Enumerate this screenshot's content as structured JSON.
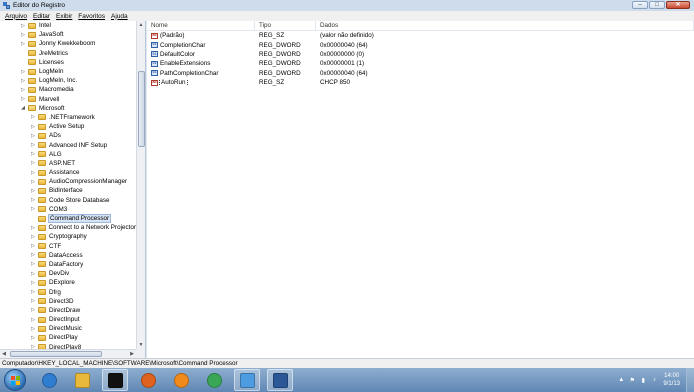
{
  "window": {
    "title": "Editor do Registro",
    "controls": {
      "minimize": "–",
      "maximize": "□",
      "close": "✕"
    }
  },
  "menu": [
    "Arquivo",
    "Editar",
    "Exibir",
    "Favoritos",
    "Ajuda"
  ],
  "tree": {
    "items": [
      {
        "label": "Intel",
        "expander": "▷"
      },
      {
        "label": "JavaSoft",
        "expander": "▷"
      },
      {
        "label": "Jonny Kwekkeboom",
        "expander": "▷"
      },
      {
        "label": "JreMetrics",
        "expander": ""
      },
      {
        "label": "Licenses",
        "expander": ""
      },
      {
        "label": "LogMeIn",
        "expander": "▷"
      },
      {
        "label": "LogMeIn, Inc.",
        "expander": "▷"
      },
      {
        "label": "Macromedia",
        "expander": "▷"
      },
      {
        "label": "Marvell",
        "expander": "▷"
      },
      {
        "label": "Microsoft",
        "expander": "◢"
      },
      {
        "label": ".NETFramework",
        "expander": "▷"
      },
      {
        "label": "Active Setup",
        "expander": "▷"
      },
      {
        "label": "ADs",
        "expander": "▷"
      },
      {
        "label": "Advanced INF Setup",
        "expander": "▷"
      },
      {
        "label": "ALG",
        "expander": "▷"
      },
      {
        "label": "ASP.NET",
        "expander": "▷"
      },
      {
        "label": "Assistance",
        "expander": "▷"
      },
      {
        "label": "AudioCompressionManager",
        "expander": "▷"
      },
      {
        "label": "BidInterface",
        "expander": "▷"
      },
      {
        "label": "Code Store Database",
        "expander": "▷"
      },
      {
        "label": "COM3",
        "expander": "▷"
      },
      {
        "label": "Command Processor",
        "expander": "",
        "selected": true
      },
      {
        "label": "Connect to a Network Projector",
        "expander": "▷"
      },
      {
        "label": "Cryptography",
        "expander": "▷"
      },
      {
        "label": "CTF",
        "expander": "▷"
      },
      {
        "label": "DataAccess",
        "expander": "▷"
      },
      {
        "label": "DataFactory",
        "expander": "▷"
      },
      {
        "label": "DevDiv",
        "expander": "▷"
      },
      {
        "label": "DExplore",
        "expander": "▷"
      },
      {
        "label": "Dfrg",
        "expander": "▷"
      },
      {
        "label": "Direct3D",
        "expander": "▷"
      },
      {
        "label": "DirectDraw",
        "expander": "▷"
      },
      {
        "label": "DirectInput",
        "expander": "▷"
      },
      {
        "label": "DirectMusic",
        "expander": "▷"
      },
      {
        "label": "DirectPlay",
        "expander": "▷"
      },
      {
        "label": "DirectPlay8",
        "expander": "▷"
      }
    ],
    "scroll": {
      "up": "▲",
      "down": "▼",
      "left": "◀",
      "right": "▶"
    }
  },
  "values": {
    "columns": [
      "Nome",
      "Tipo",
      "Dados"
    ],
    "rows": [
      {
        "name": "(Padrão)",
        "type": "REG_SZ",
        "data": "(valor não definido)",
        "icon": "ab",
        "icon_name": "string-value-icon"
      },
      {
        "name": "CompletionChar",
        "type": "REG_DWORD",
        "data": "0x00000040 (64)",
        "icon": "01",
        "icon_name": "dword-value-icon"
      },
      {
        "name": "DefaultColor",
        "type": "REG_DWORD",
        "data": "0x00000000 (0)",
        "icon": "01",
        "icon_name": "dword-value-icon"
      },
      {
        "name": "EnableExtensions",
        "type": "REG_DWORD",
        "data": "0x00000001 (1)",
        "icon": "01",
        "icon_name": "dword-value-icon"
      },
      {
        "name": "PathCompletionChar",
        "type": "REG_DWORD",
        "data": "0x00000040 (64)",
        "icon": "01",
        "icon_name": "dword-value-icon"
      },
      {
        "name": "AutoRun",
        "type": "REG_SZ",
        "data": "CHCP 850",
        "icon": "ab",
        "icon_name": "string-value-icon",
        "focused": true
      }
    ]
  },
  "status": {
    "path": "Computador\\HKEY_LOCAL_MACHINE\\SOFTWARE\\Microsoft\\Command Processor"
  },
  "taskbar": {
    "apps": [
      {
        "name": "internet-explorer-icon",
        "color": "#2f7dd1"
      },
      {
        "name": "windows-explorer-icon",
        "color": "#e8b93a"
      },
      {
        "name": "command-prompt-icon",
        "color": "#111111",
        "active": true
      },
      {
        "name": "firefox-icon",
        "color": "#e0621f"
      },
      {
        "name": "media-player-icon",
        "color": "#f08a1c"
      },
      {
        "name": "chrome-icon",
        "color": "#3aa757"
      },
      {
        "name": "registry-editor-icon",
        "color": "#4d9be0",
        "active": true
      },
      {
        "name": "word-icon",
        "color": "#2b5797",
        "active": true
      }
    ],
    "clock": {
      "time": "14:00",
      "date": "9/1/13"
    },
    "tray": [
      "▲",
      "⚑",
      "▮",
      "♪"
    ]
  }
}
